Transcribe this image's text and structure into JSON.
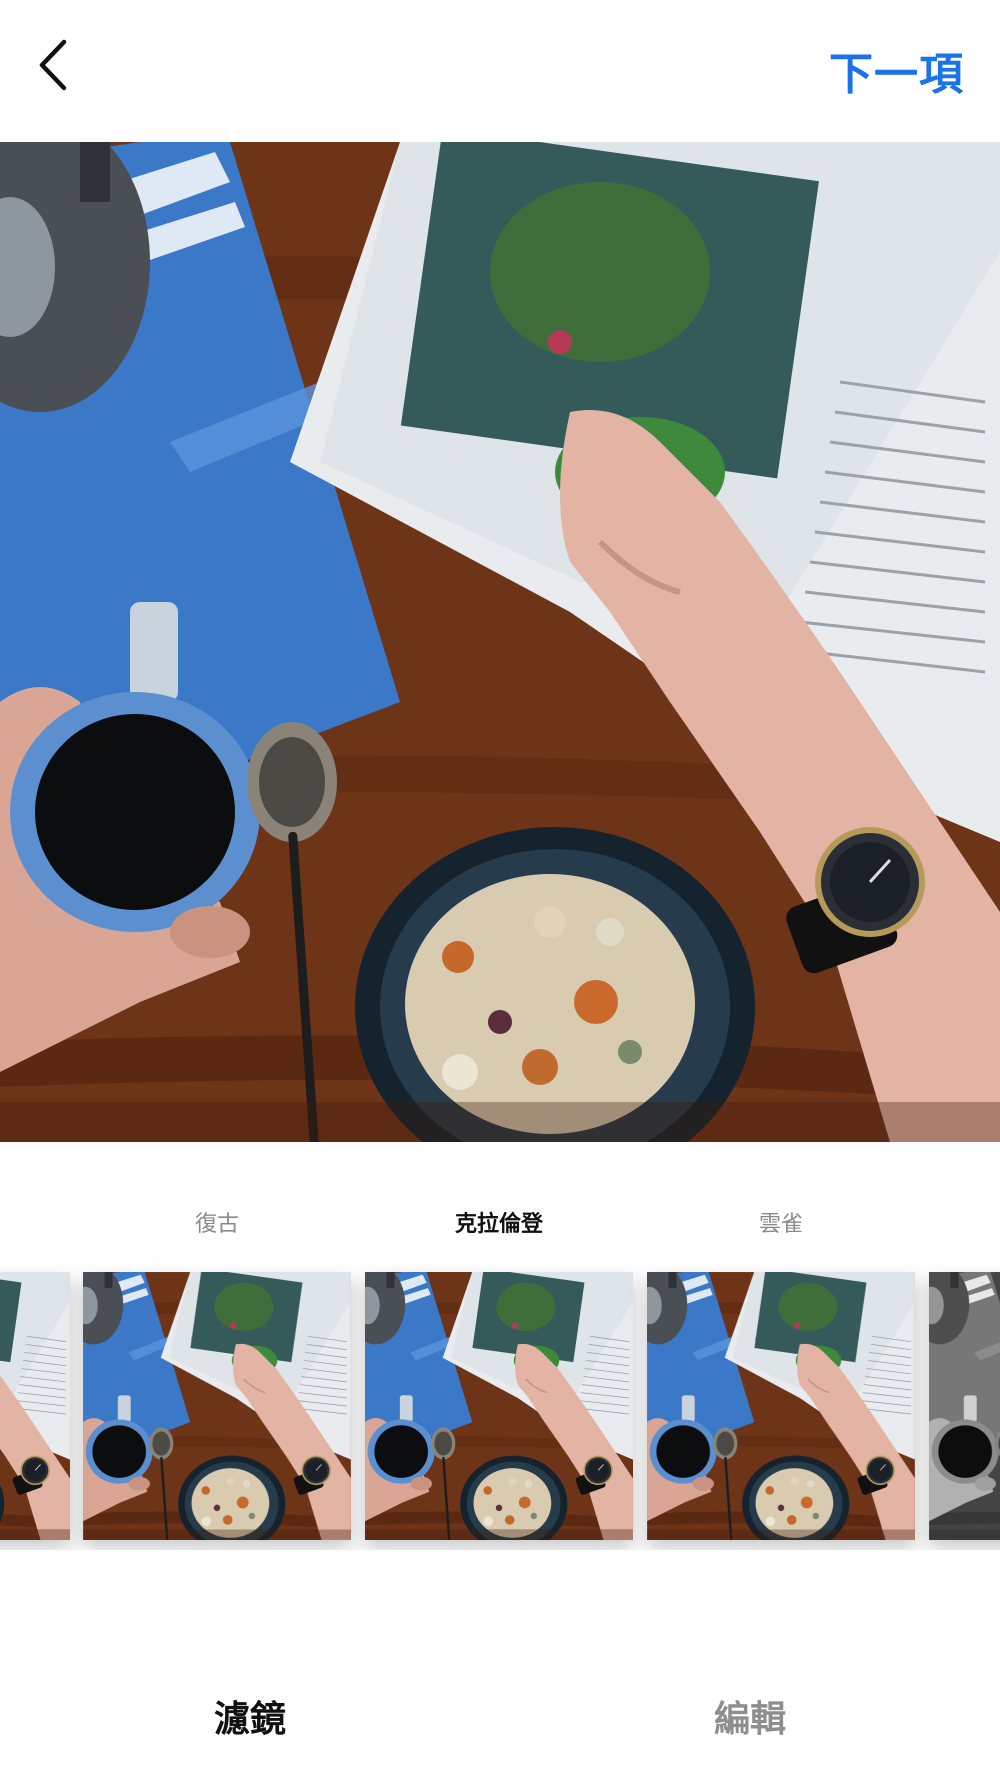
{
  "header": {
    "back_icon": "chevron-left-icon",
    "next_label": "下一項",
    "accent_color": "#1a73e8"
  },
  "filters": [
    {
      "name": "",
      "style": "partial-left"
    },
    {
      "name": "復古",
      "style": "warm"
    },
    {
      "name": "克拉倫登",
      "style": "clarendon",
      "selected": true
    },
    {
      "name": "雲雀",
      "style": "cool"
    },
    {
      "name": "",
      "style": "grayscale-partial"
    }
  ],
  "tabs": {
    "filters_label": "濾鏡",
    "edit_label": "編輯"
  }
}
